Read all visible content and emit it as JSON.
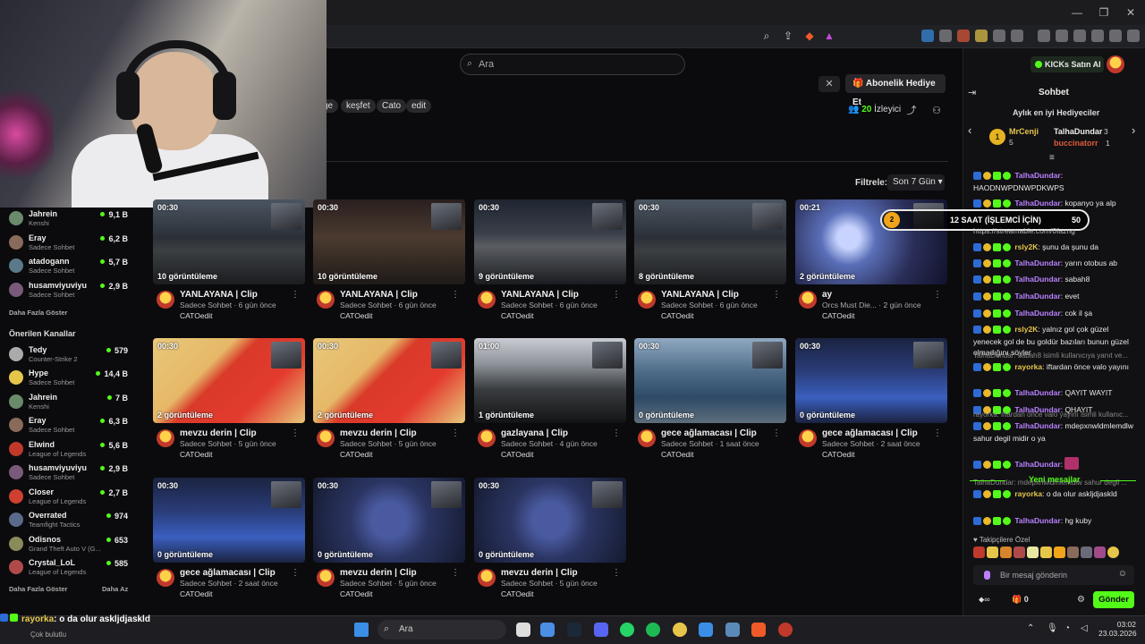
{
  "search": {
    "placeholder": "Ara"
  },
  "tags": [
    "ge",
    "keşfet",
    "Cato",
    "edit"
  ],
  "header": {
    "sub_gift_label": "Abonelik Hediye Et",
    "viewers_count": "20",
    "viewers_label": "İzleyici"
  },
  "filter": {
    "label": "Filtrele:",
    "value": "Son 7 Gün"
  },
  "sidebar": {
    "followed": [
      {
        "name": "Jahrein",
        "category": "Kenshi",
        "count": "9,1 B"
      },
      {
        "name": "Eray",
        "category": "Sadece Sohbet",
        "count": "6,2 B"
      },
      {
        "name": "atadogann",
        "category": "Sadece Sohbet",
        "count": "5,7 B"
      },
      {
        "name": "husamviyuviyu",
        "category": "Sadece Sohbet",
        "count": "2,9 B"
      }
    ],
    "show_more": "Daha Fazla Göster",
    "recommended_title": "Önerilen Kanallar",
    "recommended": [
      {
        "name": "Tedy",
        "category": "Counter-Strike 2",
        "count": "579"
      },
      {
        "name": "Hype",
        "category": "Sadece Sohbet",
        "count": "14,4 B"
      },
      {
        "name": "Jahrein",
        "category": "Kenshi",
        "count": "7 B"
      },
      {
        "name": "Eray",
        "category": "Sadece Sohbet",
        "count": "6,3 B"
      },
      {
        "name": "Elwind",
        "category": "League of Legends",
        "count": "5,6 B"
      },
      {
        "name": "husamviyuviyu",
        "category": "Sadece Sohbet",
        "count": "2,9 B"
      },
      {
        "name": "Closer",
        "category": "League of Legends",
        "count": "2,7 B"
      },
      {
        "name": "Overrated",
        "category": "Teamfight Tactics",
        "count": "974"
      },
      {
        "name": "Odisnos",
        "category": "Grand Theft Auto V (G...",
        "count": "653"
      },
      {
        "name": "Crystal_LoL",
        "category": "League of Legends",
        "count": "585"
      }
    ],
    "show_more_2": "Daha Fazla Göster",
    "show_less": "Daha Az"
  },
  "clips": [
    {
      "duration": "00:30",
      "views": "10 görüntüleme",
      "title": "YANLAYANA | Clip",
      "meta": "Sadece Sohbet · 6 gün önce",
      "channel": "CATOedit",
      "thumb": "night"
    },
    {
      "duration": "00:30",
      "views": "10 görüntüleme",
      "title": "YANLAYANA | Clip",
      "meta": "Sadece Sohbet · 6 gün önce",
      "channel": "CATOedit",
      "thumb": "dark"
    },
    {
      "duration": "00:30",
      "views": "9 görüntüleme",
      "title": "YANLAYANA | Clip",
      "meta": "Sadece Sohbet · 6 gün önce",
      "channel": "CATOedit",
      "thumb": "city"
    },
    {
      "duration": "00:30",
      "views": "8 görüntüleme",
      "title": "YANLAYANA | Clip",
      "meta": "Sadece Sohbet · 6 gün önce",
      "channel": "CATOedit",
      "thumb": "night"
    },
    {
      "duration": "00:21",
      "views": "2 görüntüleme",
      "title": "ay",
      "meta": "Orcs Must Die... · 2 gün önce",
      "channel": "CATOedit",
      "thumb": "game"
    },
    {
      "duration": "00:30",
      "views": "2 görüntüleme",
      "title": "mevzu derin | Clip",
      "meta": "Sadece Sohbet · 5 gün önce",
      "channel": "CATOedit",
      "thumb": "red"
    },
    {
      "duration": "00:30",
      "views": "2 görüntüleme",
      "title": "mevzu derin | Clip",
      "meta": "Sadece Sohbet · 5 gün önce",
      "channel": "CATOedit",
      "thumb": "red"
    },
    {
      "duration": "01:00",
      "views": "1 görüntüleme",
      "title": "gazlayana | Clip",
      "meta": "Sadece Sohbet · 4 gün önce",
      "channel": "CATOedit",
      "thumb": "drive"
    },
    {
      "duration": "00:30",
      "views": "0 görüntüleme",
      "title": "gece ağlamacası | Clip",
      "meta": "Sadece Sohbet · 1 saat önce",
      "channel": "CATOedit",
      "thumb": "aerial"
    },
    {
      "duration": "00:30",
      "views": "0 görüntüleme",
      "title": "gece ağlamacası | Clip",
      "meta": "Sadece Sohbet · 2 saat önce",
      "channel": "CATOedit",
      "thumb": "web"
    },
    {
      "duration": "00:30",
      "views": "0 görüntüleme",
      "title": "gece ağlamacası | Clip",
      "meta": "Sadece Sohbet · 2 saat önce",
      "channel": "CATOedit",
      "thumb": "web"
    },
    {
      "duration": "00:30",
      "views": "0 görüntüleme",
      "title": "mevzu derin | Clip",
      "meta": "Sadece Sohbet · 5 gün önce",
      "channel": "CATOedit",
      "thumb": "lol"
    },
    {
      "duration": "00:30",
      "views": "0 görüntüleme",
      "title": "mevzu derin | Clip",
      "meta": "Sadece Sohbet · 5 gün önce",
      "channel": "CATOedit",
      "thumb": "lol"
    }
  ],
  "chat": {
    "kicks_label": "KICKs Satın Al",
    "title": "Sohbet",
    "gifters_title": "Aylık en iyi Hediyeciler",
    "gifters": [
      {
        "rank": "1",
        "name": "MrCenji",
        "count": "5"
      },
      {
        "name": "TalhaDundar",
        "count": "3"
      },
      {
        "name": "buccinatorr",
        "count": "1"
      }
    ],
    "goal": {
      "number": "2",
      "text": "12 SAAT (İŞLEMCİ İÇİN)",
      "value": "50"
    },
    "streamable": "https://streamable.com/0fazng",
    "messages": [
      {
        "user": "TalhaDundar",
        "text": "HAODNWPDNWPDKWPS"
      },
      {
        "user": "TalhaDundar",
        "text": "kopanyo ya alp"
      },
      {
        "user": "rsly2K",
        "text": "şunu da şunu da"
      },
      {
        "user": "TalhaDundar",
        "text": "yarın otobus ab"
      },
      {
        "user": "TalhaDundar",
        "text": "sabah8"
      },
      {
        "user": "TalhaDundar",
        "text": "evet"
      },
      {
        "user": "TalhaDundar",
        "text": "cok il şa"
      },
      {
        "user": "rsly2K",
        "text": "yalnız gol çok güzel yenecek gol de bu goldür bazıları bunun güzel olmadığını söyler"
      },
      {
        "reply": "TalhaDundar: sabah8 isimli kullanıcıya yanıt ve...",
        "user": "rayorka",
        "text": "iftardan önce valo yayını"
      },
      {
        "user": "TalhaDundar",
        "text": "QAYIT WAYIT"
      },
      {
        "user": "TalhaDundar",
        "text": "QHAYIT"
      },
      {
        "reply": "rayorka: iftardan önce valo yayını isimli kullanıc...",
        "user": "TalhaDundar",
        "text": "mdepxnwldmlemdlw sahur degil midir o ya"
      },
      {
        "user": "TalhaDundar",
        "text": ""
      },
      {
        "reply": "TalhaDundar: mdepxnwldmlemdlw sahur degil ...",
        "user": "rayorka",
        "text": "o da olur askljdjaskld"
      },
      {
        "user": "TalhaDundar",
        "text": "hg kuby"
      }
    ],
    "new_messages": "Yeni mesajlar",
    "followers_only": "Takipçilere Özel",
    "input_placeholder": "Bir mesaj gönderin",
    "points": "0",
    "gifts": "0",
    "send_label": "Gönder"
  },
  "overlay": {
    "user": "rayorka",
    "text": ": o da olur askljdjaskld",
    "not_found": "Çok bulutlu"
  },
  "taskbar": {
    "search_label": "Ara",
    "time": "03:02",
    "date": "23.03.2026"
  }
}
